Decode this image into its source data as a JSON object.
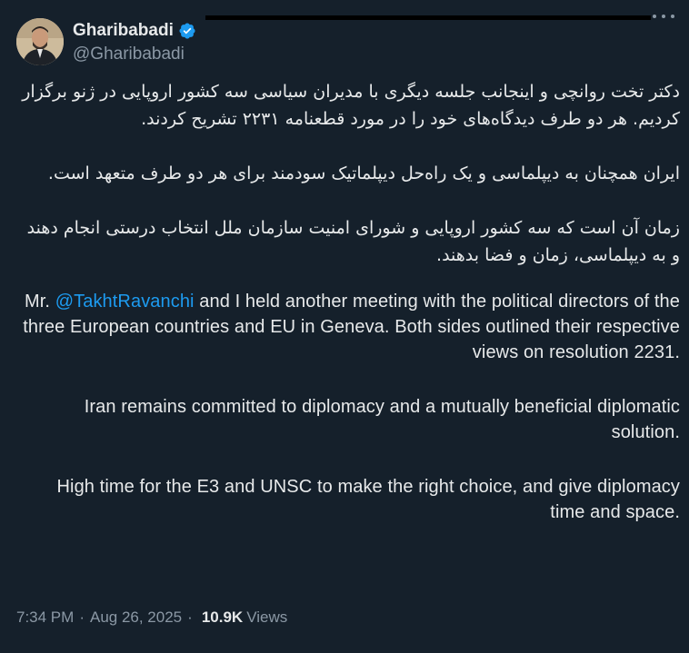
{
  "author": {
    "display_name": "Gharibabadi",
    "handle": "@Gharibabadi",
    "verified_color": "#1d9bf0"
  },
  "tweet": {
    "fa_paragraphs": [
      "دکتر تخت روانچی و اینجانب جلسه دیگری با مدیران سیاسی سه کشور اروپایی در ژنو برگزار کردیم. هر دو طرف دیدگاه‌های خود را در مورد قطعنامه ۲۲۳۱ تشریح کردند.",
      "ایران همچنان به دیپلماسی و یک راه‌حل دیپلماتیک سودمند برای هر دو طرف متعهد است.",
      "زمان آن است که سه کشور اروپایی و شورای امنیت سازمان ملل انتخاب درستی انجام دهند و به دیپلماسی، زمان و فضا بدهند."
    ],
    "en_p1_prefix": "Mr. ",
    "en_p1_mention": "@TakhtRavanchi",
    "en_p1_rest": " and I held another meeting with the political directors of the three European countries and EU in Geneva. Both sides outlined their respective views on resolution 2231.",
    "en_p2": "Iran remains committed to diplomacy and a mutually beneficial diplomatic solution.",
    "en_p3": "High time for the E3 and UNSC to make the right choice, and give diplomacy time and space."
  },
  "meta": {
    "time": "7:34 PM",
    "separator": "·",
    "date": "Aug 26, 2025",
    "views_count": "10.9K",
    "views_label": "Views"
  },
  "icons": [
    "verified-badge-icon",
    "more-options-icon"
  ]
}
